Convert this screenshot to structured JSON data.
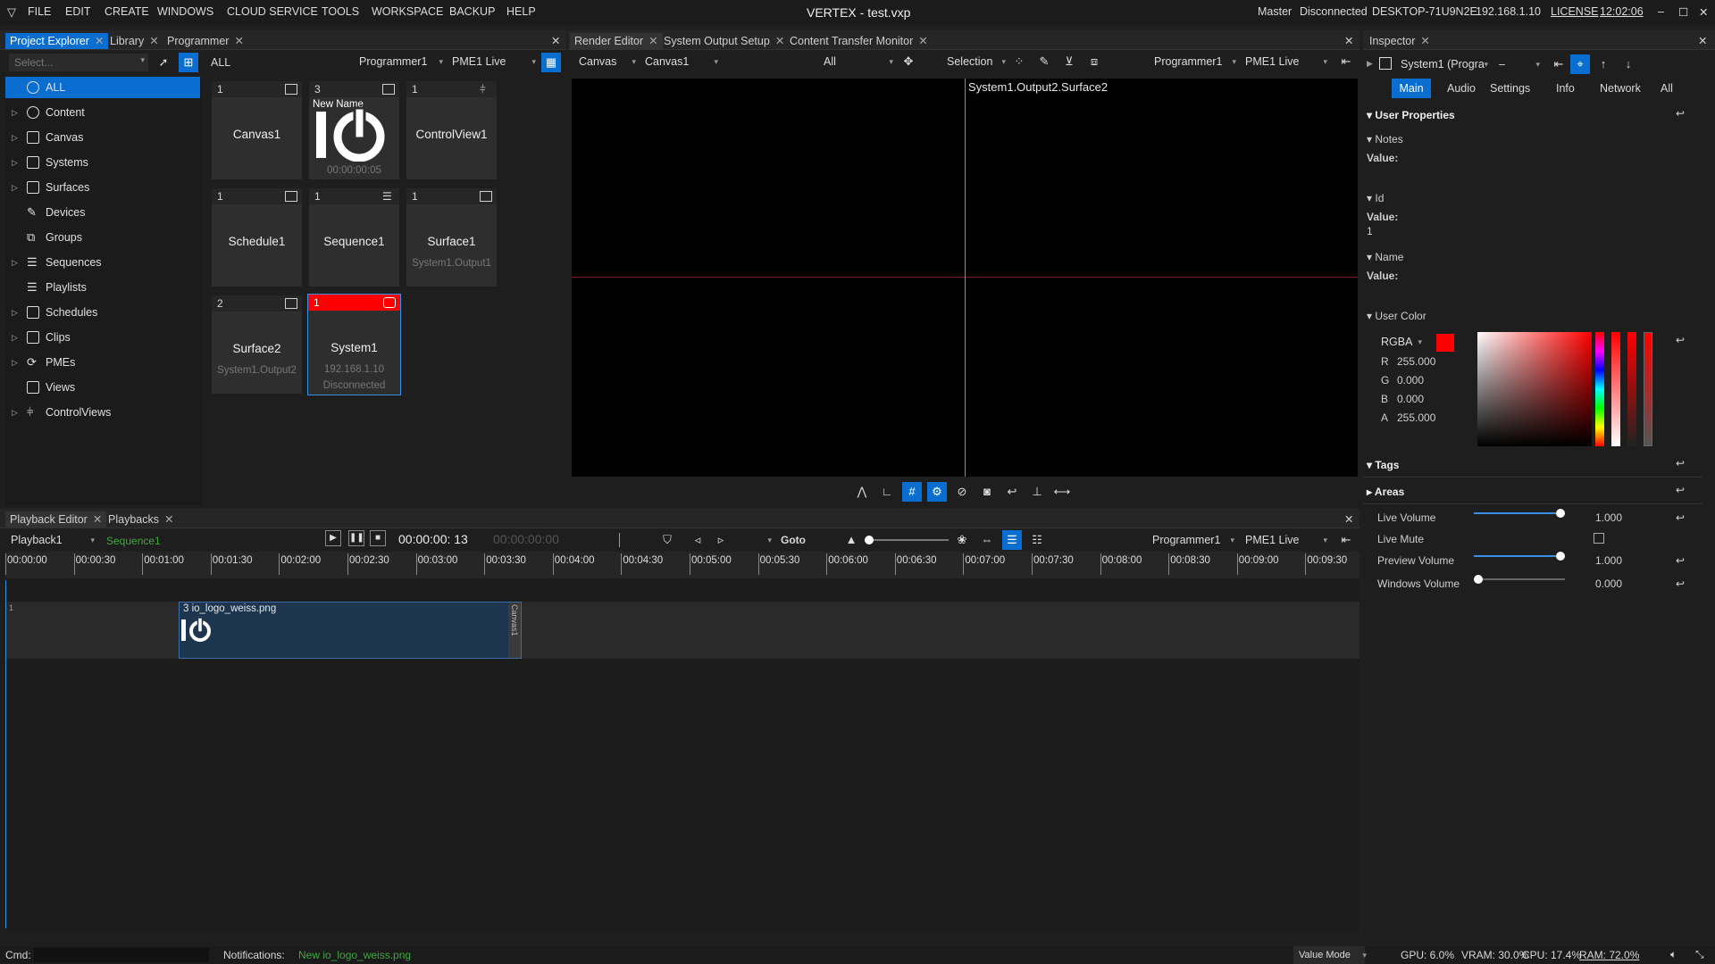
{
  "menu": {
    "items": [
      "FILE",
      "EDIT",
      "CREATE",
      "WINDOWS",
      "CLOUD SERVICE",
      "TOOLS",
      "WORKSPACE",
      "BACKUP",
      "HELP"
    ],
    "title": "VERTEX - test.vxp",
    "master": "Master",
    "conn": "Disconnected",
    "host": "DESKTOP-71U9N2E",
    "ip": "192.168.1.10",
    "license": "LICENSE",
    "time": "12:02:06"
  },
  "left_tabs": [
    "Project Explorer",
    "Library",
    "Programmer"
  ],
  "explorer": {
    "search_placeholder": "Select...",
    "tree": [
      "ALL",
      "Content",
      "Canvas",
      "Systems",
      "Surfaces",
      "Devices",
      "Groups",
      "Sequences",
      "Playlists",
      "Schedules",
      "Clips",
      "PMEs",
      "Views",
      "ControlViews"
    ],
    "filter": "ALL",
    "prog": "Programmer1",
    "pme": "PME1 Live"
  },
  "tiles": [
    {
      "count": "1",
      "name": "Canvas1",
      "sub": ""
    },
    {
      "count": "3",
      "name": "",
      "sub": "00:00:00:05",
      "overlay": "New Name"
    },
    {
      "count": "1",
      "name": "ControlView1",
      "sub": ""
    },
    {
      "count": "1",
      "name": "Schedule1",
      "sub": ""
    },
    {
      "count": "1",
      "name": "Sequence1",
      "sub": ""
    },
    {
      "count": "1",
      "name": "Surface1",
      "sub": "System1.Output1"
    },
    {
      "count": "2",
      "name": "Surface2",
      "sub": "System1.Output2"
    },
    {
      "count": "1",
      "name": "System1",
      "sub": "192.168.1.10",
      "sub2": "Disconnected"
    }
  ],
  "center_tabs": [
    "Render Editor",
    "System Output Setup",
    "Content Transfer Monitor"
  ],
  "render": {
    "mode": "Canvas",
    "canvas": "Canvas1",
    "filter": "All",
    "tool": "Selection",
    "prog": "Programmer1",
    "pme": "PME1 Live",
    "label": "System1.Output2.Surface2"
  },
  "inspector": {
    "tab": "Inspector",
    "object": "System1 (Progra",
    "dash": "–",
    "subtabs": [
      "Main",
      "Audio",
      "Settings",
      "Info",
      "Network",
      "All"
    ],
    "user_props": "User Properties",
    "notes": "Notes",
    "value": "Value:",
    "id": "Id",
    "id_val": "1",
    "name": "Name",
    "user_color": "User Color",
    "mode": "RGBA",
    "r_lbl": "R",
    "r": "255.000",
    "g_lbl": "G",
    "g": "0.000",
    "b_lbl": "B",
    "b": "0.000",
    "a_lbl": "A",
    "a": "255.000",
    "tags": "Tags",
    "areas": "Areas",
    "audio": [
      {
        "label": "Live Volume",
        "value": "1.000",
        "level": 1.0
      },
      {
        "label": "Live Mute",
        "value": ""
      },
      {
        "label": "Preview Volume",
        "value": "1.000",
        "level": 1.0
      },
      {
        "label": "Windows Volume",
        "value": "0.000",
        "level": 0.0
      }
    ]
  },
  "playback": {
    "tabs": [
      "Playback Editor",
      "Playbacks"
    ],
    "playback": "Playback1",
    "sequence": "Sequence1",
    "timecode": "00:00:00: 13",
    "timecode2": "00:00:00:00",
    "goto": "Goto",
    "prog": "Programmer1",
    "pme": "PME1 Live",
    "ruler": [
      "00:00:00",
      "00:00:30",
      "00:01:00",
      "00:01:30",
      "00:02:00",
      "00:02:30",
      "00:03:00",
      "00:03:30",
      "00:04:00",
      "00:04:30",
      "00:05:00",
      "00:05:30",
      "00:06:00",
      "00:06:30",
      "00:07:00",
      "00:07:30",
      "00:08:00",
      "00:08:30",
      "00:09:00",
      "00:09:30"
    ],
    "track": "1",
    "clip": "3 io_logo_weiss.png",
    "clip_side": "Canvas1"
  },
  "status": {
    "cmd": "Cmd:",
    "notif": "Notifications:",
    "notif_msg": "New io_logo_weiss.png",
    "mode": "Value Mode",
    "gpu": "GPU: 6.0%",
    "vram": "VRAM: 30.0%",
    "cpu": "CPU: 17.4%",
    "ram": "RAM: 72.0%"
  },
  "colors": {
    "accent": "#0a6ed1",
    "red": "#ff0000",
    "green": "#3fa63f"
  }
}
